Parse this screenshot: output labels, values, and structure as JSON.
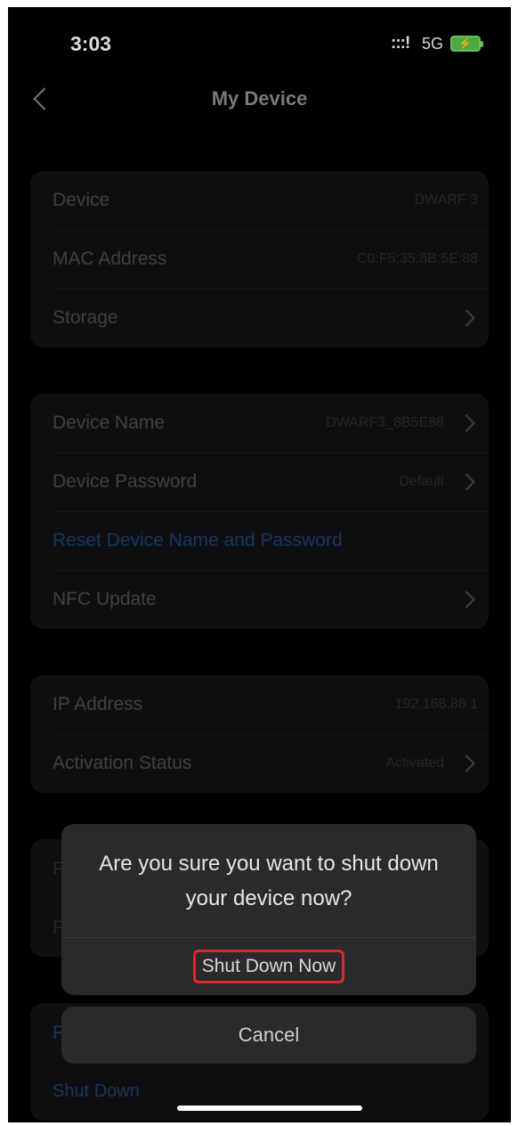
{
  "status": {
    "time": "3:03",
    "signal": ":::!",
    "network": "5G",
    "battery_icon": "battery-charging-icon"
  },
  "nav": {
    "title": "My Device",
    "back_icon": "chevron-left-icon"
  },
  "group1": [
    {
      "label": "Device",
      "value": "DWARF 3"
    },
    {
      "label": "MAC Address",
      "value": "C0:F5:35:8B:5E:88"
    },
    {
      "label": "Storage",
      "value": ""
    }
  ],
  "group2": [
    {
      "label": "Device Name",
      "value": "DWARF3_8B5E88"
    },
    {
      "label": "Device Password",
      "value": "Default"
    },
    {
      "label": "Reset Device Name and Password",
      "value": ""
    },
    {
      "label": "NFC Update",
      "value": ""
    }
  ],
  "group3": [
    {
      "label": "IP Address",
      "value": "192.168.88.1"
    },
    {
      "label": "Activation Status",
      "value": "Activated"
    }
  ],
  "group4_partial": [
    "F",
    "F"
  ],
  "group5": {
    "partial": "F",
    "shutdown_label": "Shut Down"
  },
  "dialog": {
    "message": "Are you sure you want to shut down your device now?",
    "confirm": "Shut Down Now",
    "cancel": "Cancel",
    "highlight_color": "#e0282b"
  },
  "colors": {
    "link": "#1c3f70",
    "background": "#000000",
    "sheet": "#2a2a2c"
  }
}
